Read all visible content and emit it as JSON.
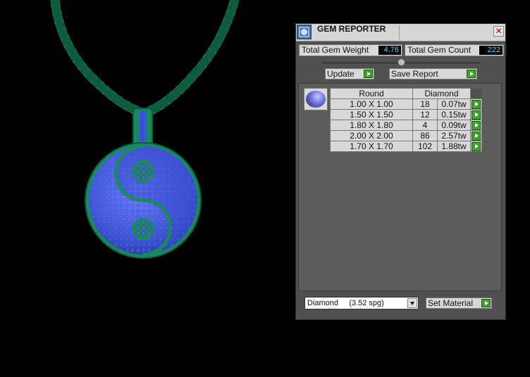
{
  "panel": {
    "title": "GEM REPORTER",
    "close_glyph": "✕",
    "total_weight_label": "Total Gem Weight",
    "total_weight_value": "4.76",
    "total_count_label": "Total Gem Count",
    "total_count_value": "222",
    "update_label": "Update",
    "save_label": "Save Report",
    "table": {
      "headers": [
        "Round",
        "Diamond"
      ],
      "rows": [
        {
          "size": "1.00 X 1.00",
          "count": "18",
          "weight": "0.07tw"
        },
        {
          "size": "1.50 X 1.50",
          "count": "12",
          "weight": "0.15tw"
        },
        {
          "size": "1.80 X 1.80",
          "count": "4",
          "weight": "0.09tw"
        },
        {
          "size": "2.00 X 2.00",
          "count": "86",
          "weight": "2.57tw"
        },
        {
          "size": "1.70 X 1.70",
          "count": "102",
          "weight": "1.88tw"
        }
      ]
    },
    "material_value": "Diamond     (3.52 spg)",
    "set_material_label": "Set Material"
  },
  "colors": {
    "metal_green": "#1f9a6a",
    "gem_blue": "#3a55e0",
    "accent_green": "#3ea22c"
  }
}
